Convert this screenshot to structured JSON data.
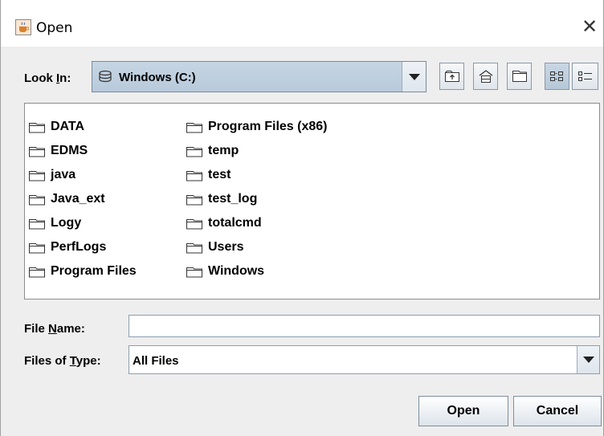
{
  "window": {
    "title": "Open",
    "close_glyph": "✕"
  },
  "look_in": {
    "label_prefix": "Look ",
    "label_mnemonic": "I",
    "label_suffix": "n:",
    "value": "Windows (C:)"
  },
  "toolbar": {
    "buttons": [
      "up-one-level-icon",
      "home-icon",
      "new-folder-icon",
      "list-view-icon",
      "details-view-icon"
    ],
    "selected": "list-view-icon"
  },
  "files": {
    "column1": [
      "DATA",
      "EDMS",
      "java",
      "Java_ext",
      "Logy",
      "PerfLogs",
      "Program Files"
    ],
    "column2": [
      "Program Files (x86)",
      "temp",
      "test",
      "test_log",
      "totalcmd",
      "Users",
      "Windows"
    ]
  },
  "file_name": {
    "label_prefix": "File ",
    "label_mnemonic": "N",
    "label_suffix": "ame:",
    "value": ""
  },
  "file_type": {
    "label_prefix": "Files of ",
    "label_mnemonic": "T",
    "label_suffix": "ype:",
    "value": "All Files"
  },
  "buttons": {
    "open": "Open",
    "cancel": "Cancel"
  },
  "colors": {
    "combo_selected": "#c6d5e3",
    "border": "#7a8a99"
  }
}
